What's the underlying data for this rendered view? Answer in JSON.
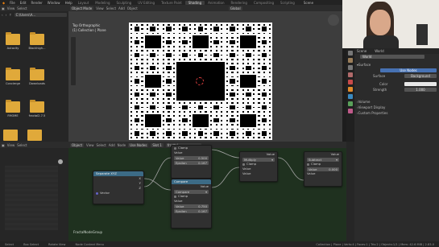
{
  "topbar": {
    "menus": [
      "File",
      "Edit",
      "Render",
      "Window",
      "Help"
    ],
    "workspaces": [
      "Layout",
      "Modeling",
      "Sculpting",
      "UV Editing",
      "Texture Paint",
      "Shading",
      "Animation",
      "Rendering",
      "Compositing",
      "Scripting"
    ],
    "active_workspace": "Shading",
    "scene": "Scene",
    "options": "Options"
  },
  "filebrowser": {
    "view": "View",
    "select": "Select",
    "path": "C:\\Users\\A...",
    "folders": [
      "Autocity",
      "Blockhigh...",
      "Concierge",
      "Downloads",
      "FMOME",
      "fractal2.7.5"
    ]
  },
  "viewport": {
    "mode": "Object Mode",
    "menus": [
      "View",
      "Select",
      "Add",
      "Object"
    ],
    "shading": "Global",
    "title": "Top Orthographic",
    "subtitle": "(1) Collection | Plane"
  },
  "properties": {
    "scene_label": "Scene",
    "world_label": "World",
    "world_name": "World",
    "surface_header": "Surface",
    "use_nodes": "Use Nodes",
    "surface_label": "Surface",
    "surface_value": "Background",
    "color_label": "Color",
    "strength_label": "Strength",
    "strength_value": "1.000",
    "sections": [
      "Volume",
      "Viewport Display",
      "Custom Properties"
    ]
  },
  "node_editor": {
    "object": "Object",
    "menus": [
      "View",
      "Select",
      "Add",
      "Node"
    ],
    "use_nodes": "Use Nodes",
    "slot": "Slot 1",
    "material": "fractal",
    "group_label": "FractalNodeGroup",
    "nodes": {
      "separate": {
        "title": "Separate XYZ",
        "outputs": [
          "X",
          "Y",
          "Z"
        ],
        "input": "Vector"
      },
      "compare_top": {
        "clamp": "Clamp",
        "value_label": "Value",
        "value": "0.500",
        "epsilon_label": "Epsilon",
        "epsilon": "0.167"
      },
      "compare_mid": {
        "title": "Compare",
        "value": "Value",
        "op": "Compare",
        "clamp": "Clamp",
        "value2": "Value",
        "value_field": "0.750",
        "epsilon_label": "Epsilon",
        "epsilon": "0.167"
      },
      "multiply": {
        "value": "Value",
        "op": "Multiply",
        "clamp": "Clamp",
        "in": "Value"
      },
      "subtract": {
        "value": "Value",
        "op": "Subtract",
        "clamp": "Clamp",
        "value_field": "0.000",
        "in": "Value"
      }
    }
  },
  "sidepanel": {
    "menus": [
      "View",
      "Select"
    ]
  },
  "status": {
    "select": "Select",
    "box": "Box Select",
    "rotate": "Rotate View",
    "context": "Node Context Menu",
    "info": "Collection | Plane | Verts:4 | Faces:1 | Tris:2 | Objects:1/1 | Mem: 42.6 MiB | 2.83.0"
  },
  "colors": {
    "accent": "#4772b3",
    "folder": "#e0a93a",
    "node_bg": "#1f311f"
  }
}
